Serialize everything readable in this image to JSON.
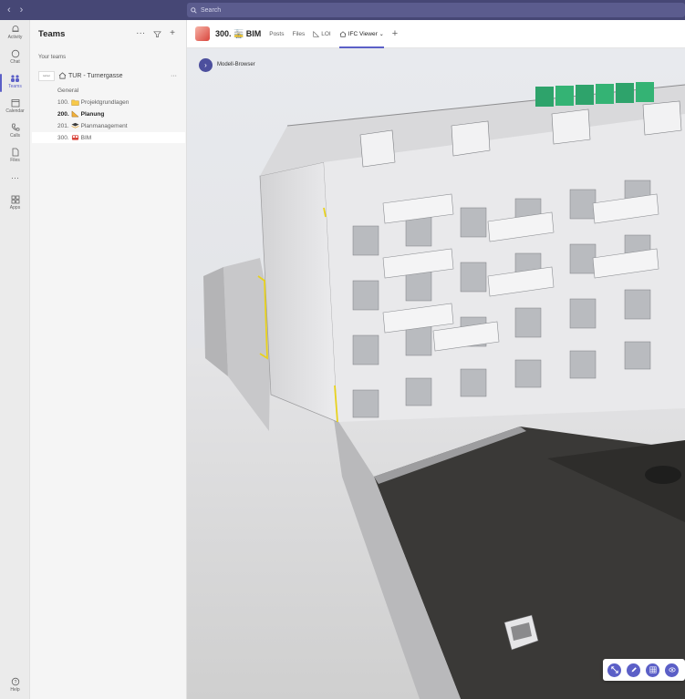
{
  "search": {
    "placeholder": "Search"
  },
  "rail": [
    {
      "label": "Activity",
      "icon": "bell-icon"
    },
    {
      "label": "Chat",
      "icon": "chat-icon"
    },
    {
      "label": "Teams",
      "icon": "teams-icon"
    },
    {
      "label": "Calendar",
      "icon": "calendar-icon"
    },
    {
      "label": "Calls",
      "icon": "phone-icon"
    },
    {
      "label": "Files",
      "icon": "file-icon"
    },
    {
      "label": "Apps",
      "icon": "apps-icon"
    },
    {
      "label": "Help",
      "icon": "help-icon"
    }
  ],
  "teams_pane": {
    "title": "Teams",
    "section": "Your teams",
    "team": {
      "name": "TUR - Turnergasse",
      "logo_text": "turner"
    },
    "channels": [
      {
        "num": "General",
        "name": ""
      },
      {
        "num": "100.",
        "name": "Projektgrundlagen"
      },
      {
        "num": "200.",
        "name": "Planung"
      },
      {
        "num": "201.",
        "name": "Planmanagement"
      },
      {
        "num": "300.",
        "name": "BIM"
      }
    ]
  },
  "header": {
    "title": "300. 🚋 BIM",
    "tabs": [
      "Posts",
      "Files",
      "LOI",
      "IFC Viewer"
    ]
  },
  "viewer": {
    "model_browser": "Modell-Browser"
  },
  "colors": {
    "brand": "#464775",
    "accent": "#5b5fc7"
  }
}
